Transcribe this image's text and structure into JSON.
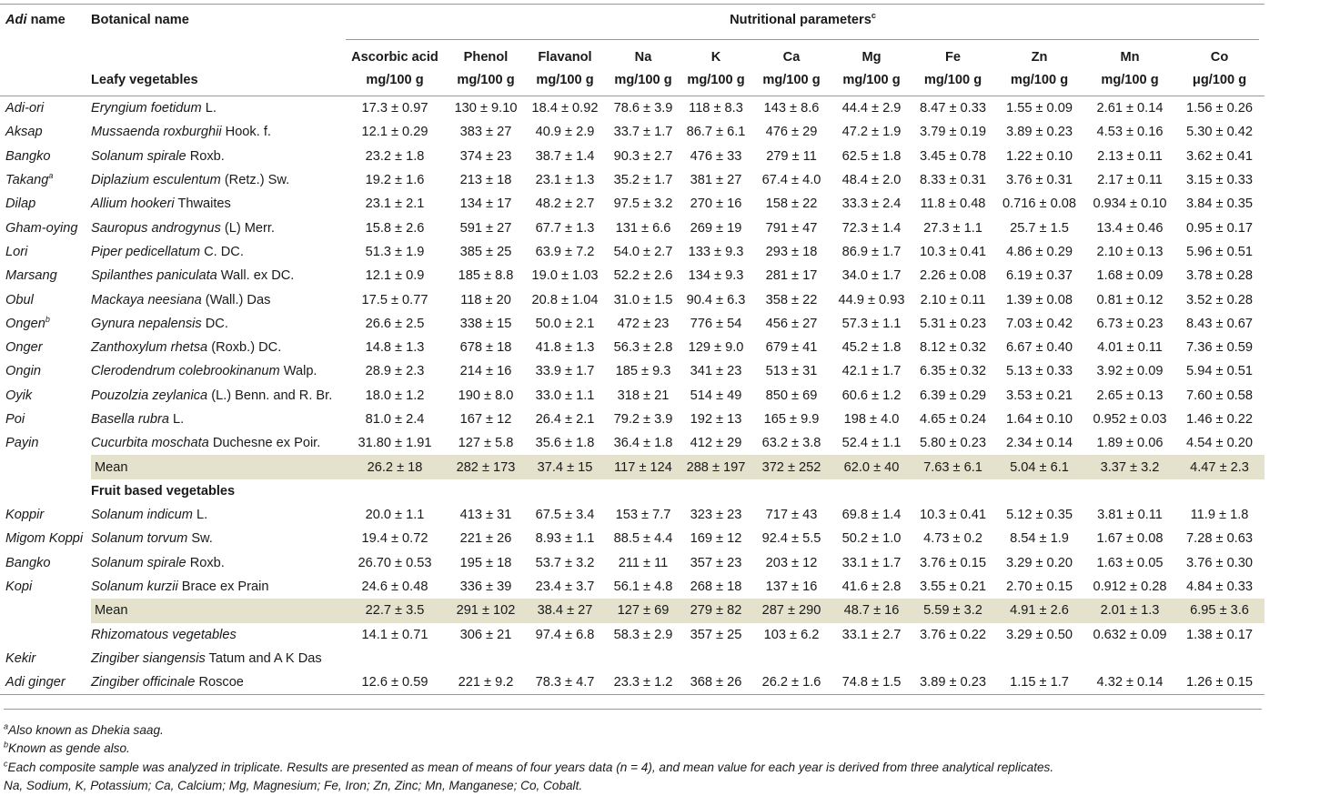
{
  "header": {
    "adi_name_label": "Adi",
    "adi_name_suffix": "name",
    "botanical_label": "Botanical name",
    "group_label": "Nutritional parameters",
    "group_sup": "c",
    "leafy_label": "Leafy vegetables",
    "parameters": [
      "Ascorbic acid",
      "Phenol",
      "Flavanol",
      "Na",
      "K",
      "Ca",
      "Mg",
      "Fe",
      "Zn",
      "Mn",
      "Co"
    ],
    "units": [
      "mg/100 g",
      "mg/100 g",
      "mg/100 g",
      "mg/100 g",
      "mg/100 g",
      "mg/100 g",
      "mg/100 g",
      "mg/100 g",
      "mg/100 g",
      "mg/100 g",
      "μg/100 g"
    ]
  },
  "rows": [
    {
      "kind": "data",
      "adi": "Adi-ori",
      "bot_it": "Eryngium foetidum",
      "bot_rest": " L.",
      "vals": [
        "17.3 ± 0.97",
        "130 ± 9.10",
        "18.4 ± 0.92",
        "78.6 ± 3.9",
        "118 ± 8.3",
        "143 ± 8.6",
        "44.4 ± 2.9",
        "8.47 ± 0.33",
        "1.55 ± 0.09",
        "2.61 ± 0.14",
        "1.56 ± 0.26"
      ]
    },
    {
      "kind": "data",
      "adi": "Aksap",
      "bot_it": "Mussaenda roxburghii",
      "bot_rest": " Hook. f.",
      "vals": [
        "12.1 ± 0.29",
        "383 ± 27",
        "40.9 ± 2.9",
        "33.7 ± 1.7",
        "86.7 ± 6.1",
        "476 ± 29",
        "47.2 ± 1.9",
        "3.79 ± 0.19",
        "3.89 ± 0.23",
        "4.53 ± 0.16",
        "5.30 ± 0.42"
      ]
    },
    {
      "kind": "data",
      "adi": "Bangko",
      "bot_it": "Solanum spirale",
      "bot_rest": " Roxb.",
      "vals": [
        "23.2 ± 1.8",
        "374 ± 23",
        "38.7 ± 1.4",
        "90.3 ± 2.7",
        "476 ± 33",
        "279 ± 11",
        "62.5 ± 1.8",
        "3.45 ± 0.78",
        "1.22 ± 0.10",
        "2.13 ± 0.11",
        "3.62 ± 0.41"
      ]
    },
    {
      "kind": "data",
      "adi": "Takang",
      "adi_sup": "a",
      "bot_it": "Diplazium esculentum",
      "bot_rest": " (Retz.) Sw.",
      "vals": [
        "19.2 ± 1.6",
        "213 ± 18",
        "23.1 ± 1.3",
        "35.2 ± 1.7",
        "381 ± 27",
        "67.4 ± 4.0",
        "48.4 ± 2.0",
        "8.33 ± 0.31",
        "3.76 ± 0.31",
        "2.17 ± 0.11",
        "3.15 ± 0.33"
      ]
    },
    {
      "kind": "data",
      "adi": "Dilap",
      "bot_it": "Allium hookeri",
      "bot_rest": " Thwaites",
      "vals": [
        "23.1 ± 2.1",
        "134 ± 17",
        "48.2 ± 2.7",
        "97.5 ± 3.2",
        "270 ± 16",
        "158 ± 22",
        "33.3 ± 2.4",
        "11.8 ± 0.48",
        "0.716 ± 0.08",
        "0.934 ± 0.10",
        "3.84 ± 0.35"
      ]
    },
    {
      "kind": "data",
      "adi": "Gham-oying",
      "bot_it": "Sauropus androgynus",
      "bot_rest": " (L) Merr.",
      "vals": [
        "15.8 ± 2.6",
        "591 ± 27",
        "67.7 ± 1.3",
        "131 ± 6.6",
        "269 ± 19",
        "791 ± 47",
        "72.3 ± 1.4",
        "27.3 ± 1.1",
        "25.7 ± 1.5",
        "13.4 ± 0.46",
        "0.95 ± 0.17"
      ]
    },
    {
      "kind": "data",
      "adi": "Lori",
      "bot_it": "Piper pedicellatum",
      "bot_rest": " C. DC.",
      "vals": [
        "51.3 ± 1.9",
        "385 ± 25",
        "63.9 ± 7.2",
        "54.0 ± 2.7",
        "133 ± 9.3",
        "293 ± 18",
        "86.9 ± 1.7",
        "10.3 ± 0.41",
        "4.86 ± 0.29",
        "2.10 ± 0.13",
        "5.96 ± 0.51"
      ]
    },
    {
      "kind": "data",
      "adi": "Marsang",
      "bot_it": "Spilanthes paniculata",
      "bot_rest": " Wall. ex DC.",
      "vals": [
        "12.1 ± 0.9",
        "185 ± 8.8",
        "19.0 ± 1.03",
        "52.2 ± 2.6",
        "134 ± 9.3",
        "281 ± 17",
        "34.0 ± 1.7",
        "2.26 ± 0.08",
        "6.19 ± 0.37",
        "1.68 ± 0.09",
        "3.78 ± 0.28"
      ]
    },
    {
      "kind": "data",
      "adi": "Obul",
      "bot_it": "Mackaya neesiana",
      "bot_rest": " (Wall.) Das",
      "vals": [
        "17.5 ± 0.77",
        "118 ± 20",
        "20.8 ± 1.04",
        "31.0 ± 1.5",
        "90.4 ± 6.3",
        "358 ± 22",
        "44.9 ± 0.93",
        "2.10 ± 0.11",
        "1.39 ± 0.08",
        "0.81 ± 0.12",
        "3.52 ± 0.28"
      ]
    },
    {
      "kind": "data",
      "adi": "Ongen",
      "adi_sup": "b",
      "bot_it": "Gynura nepalensis",
      "bot_rest": " DC.",
      "vals": [
        "26.6 ± 2.5",
        "338 ± 15",
        "50.0 ± 2.1",
        "472 ± 23",
        "776 ± 54",
        "456 ± 27",
        "57.3 ± 1.1",
        "5.31 ± 0.23",
        "7.03 ± 0.42",
        "6.73 ± 0.23",
        "8.43 ± 0.67"
      ]
    },
    {
      "kind": "data",
      "adi": "Onger",
      "bot_it": "Zanthoxylum rhetsa",
      "bot_rest": " (Roxb.) DC.",
      "vals": [
        "14.8 ± 1.3",
        "678 ± 18",
        "41.8 ± 1.3",
        "56.3 ± 2.8",
        "129 ± 9.0",
        "679 ± 41",
        "45.2 ± 1.8",
        "8.12 ± 0.32",
        "6.67 ± 0.40",
        "4.01 ± 0.11",
        "7.36 ± 0.59"
      ]
    },
    {
      "kind": "data",
      "adi": "Ongin",
      "bot_it": "Clerodendrum colebrookinanum",
      "bot_rest": " Walp.",
      "vals": [
        "28.9 ± 2.3",
        "214 ± 16",
        "33.9 ± 1.7",
        "185 ± 9.3",
        "341 ± 23",
        "513 ± 31",
        "42.1 ± 1.7",
        "6.35 ± 0.32",
        "5.13 ± 0.33",
        "3.92 ± 0.09",
        "5.94 ± 0.51"
      ]
    },
    {
      "kind": "data",
      "adi": "Oyik",
      "bot_it": "Pouzolzia zeylanica",
      "bot_rest": " (L.) Benn. and R. Br.",
      "vals": [
        "18.0 ± 1.2",
        "190 ± 8.0",
        "33.0 ± 1.1",
        "318 ± 21",
        "514 ± 49",
        "850 ± 69",
        "60.6 ± 1.2",
        "6.39 ± 0.29",
        "3.53 ± 0.21",
        "2.65 ± 0.13",
        "7.60 ± 0.58"
      ]
    },
    {
      "kind": "data",
      "adi": "Poi",
      "bot_it": "Basella rubra",
      "bot_rest": " L.",
      "vals": [
        "81.0 ± 2.4",
        "167 ± 12",
        "26.4 ± 2.1",
        "79.2 ± 3.9",
        "192 ± 13",
        "165 ± 9.9",
        "198 ± 4.0",
        "4.65 ± 0.24",
        "1.64 ± 0.10",
        "0.952 ± 0.03",
        "1.46 ± 0.22"
      ]
    },
    {
      "kind": "data",
      "adi": "Payin",
      "bot_it": "Cucurbita moschata",
      "bot_rest": " Duchesne ex Poir.",
      "vals": [
        "31.80 ± 1.91",
        "127 ± 5.8",
        "35.6 ± 1.8",
        "36.4 ± 1.8",
        "412 ± 29",
        "63.2 ± 3.8",
        "52.4 ± 1.1",
        "5.80 ± 0.23",
        "2.34 ± 0.14",
        "1.89 ± 0.06",
        "4.54 ± 0.20"
      ]
    },
    {
      "kind": "mean",
      "label": "Mean",
      "vals": [
        "26.2 ± 18",
        "282 ± 173",
        "37.4 ± 15",
        "117 ± 124",
        "288 ± 197",
        "372 ± 252",
        "62.0 ± 40",
        "7.63 ± 6.1",
        "5.04 ± 6.1",
        "3.37 ± 3.2",
        "4.47 ± 2.3"
      ]
    },
    {
      "kind": "section",
      "label": "Fruit based vegetables"
    },
    {
      "kind": "data",
      "adi": "Koppir",
      "bot_it": "Solanum indicum",
      "bot_rest": " L.",
      "vals": [
        "20.0 ± 1.1",
        "413 ± 31",
        "67.5 ± 3.4",
        "153 ± 7.7",
        "323 ± 23",
        "717 ± 43",
        "69.8 ± 1.4",
        "10.3 ± 0.41",
        "5.12 ± 0.35",
        "3.81 ± 0.11",
        "11.9 ± 1.8"
      ]
    },
    {
      "kind": "data",
      "adi": "Migom Koppi",
      "bot_it": "Solanum torvum",
      "bot_rest": " Sw.",
      "vals": [
        "19.4 ± 0.72",
        "221 ± 26",
        "8.93 ± 1.1",
        "88.5 ± 4.4",
        "169 ± 12",
        "92.4 ± 5.5",
        "50.2 ± 1.0",
        "4.73 ± 0.2",
        "8.54 ± 1.9",
        "1.67 ± 0.08",
        "7.28 ± 0.63"
      ]
    },
    {
      "kind": "data",
      "adi": "Bangko",
      "bot_it": "Solanum spirale",
      "bot_rest": " Roxb.",
      "vals": [
        "26.70 ± 0.53",
        "195 ± 18",
        "53.7 ± 3.2",
        "211 ± 11",
        "357 ± 23",
        "203 ± 12",
        "33.1 ± 1.7",
        "3.76 ± 0.15",
        "3.29 ± 0.20",
        "1.63 ± 0.05",
        "3.76 ± 0.30"
      ]
    },
    {
      "kind": "data",
      "adi": "Kopi",
      "bot_it": "Solanum kurzii",
      "bot_rest": " Brace ex Prain",
      "vals": [
        "24.6 ± 0.48",
        "336 ± 39",
        "23.4 ± 3.7",
        "56.1 ± 4.8",
        "268 ± 18",
        "137 ± 16",
        "41.6 ± 2.8",
        "3.55 ± 0.21",
        "2.70 ± 0.15",
        "0.912 ± 0.28",
        "4.84 ± 0.33"
      ]
    },
    {
      "kind": "mean",
      "label": "Mean",
      "vals": [
        "22.7 ± 3.5",
        "291 ± 102",
        "38.4 ± 27",
        "127 ± 69",
        "279 ± 82",
        "287 ± 290",
        "48.7 ± 16",
        "5.59 ± 3.2",
        "4.91 ± 2.6",
        "2.01 ± 1.3",
        "6.95 ± 3.6"
      ]
    },
    {
      "kind": "plain",
      "adi": "",
      "bot_it": "Rhizomatous vegetables",
      "bot_rest": "",
      "vals": [
        "14.1 ± 0.71",
        "306 ± 21",
        "97.4 ± 6.8",
        "58.3 ± 2.9",
        "357 ± 25",
        "103 ± 6.2",
        "33.1 ± 2.7",
        "3.76 ± 0.22",
        "3.29 ± 0.50",
        "0.632 ± 0.09",
        "1.38 ± 0.17"
      ]
    },
    {
      "kind": "data",
      "adi": "Kekir",
      "bot_it": "Zingiber siangensis",
      "bot_rest": " Tatum and A K Das",
      "vals": [
        "",
        "",
        "",
        "",
        "",
        "",
        "",
        "",
        "",
        "",
        ""
      ]
    },
    {
      "kind": "data",
      "adi": "Adi ginger",
      "bot_it": "Zingiber officinale",
      "bot_rest": " Roscoe",
      "vals": [
        "12.6 ± 0.59",
        "221 ± 9.2",
        "78.3 ± 4.7",
        "23.3 ± 1.2",
        "368 ± 26",
        "26.2 ± 1.6",
        "74.8 ± 1.5",
        "3.89 ± 0.23",
        "1.15 ± 1.7",
        "4.32 ± 0.14",
        "1.26 ± 0.15"
      ]
    }
  ],
  "footnotes": {
    "a_sup": "a",
    "a_text": "Also known as Dhekia saag.",
    "b_sup": "b",
    "b_text": "Known as gende also.",
    "c_sup": "c",
    "c_text": "Each composite sample was analyzed in triplicate. Results are presented as mean of means of four years data (n = 4), and mean value for each year is derived from three analytical replicates.",
    "abbrev": "Na, Sodium, K, Potassium; Ca, Calcium; Mg, Magnesium; Fe, Iron; Zn, Zinc; Mn, Manganese; Co, Cobalt."
  }
}
